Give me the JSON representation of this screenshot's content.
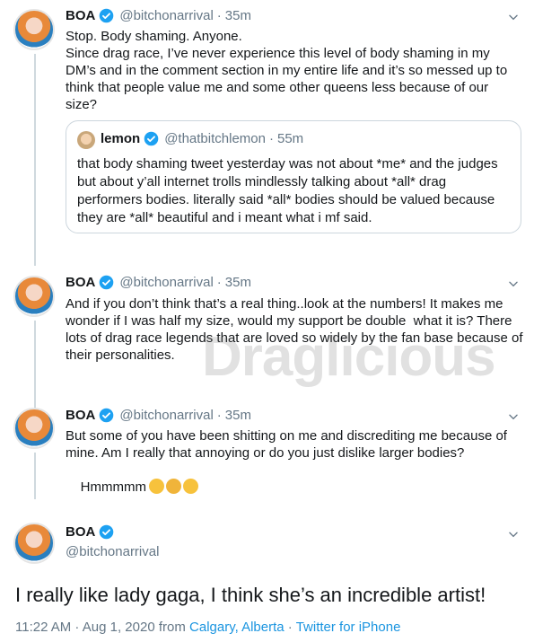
{
  "tweets": [
    {
      "name": "BOA",
      "handle": "@bitchonarrival",
      "time": "35m",
      "text": "Stop. Body shaming. Anyone.\nSince drag race, I’ve never experience this level of body shaming in my DM’s and in the comment section in my entire life and it’s so messed up to think that people value me and some other queens less because of our size?",
      "quote": {
        "name": "lemon",
        "handle": "@thatbitchlemon",
        "time": "55m",
        "text": "that body shaming tweet yesterday was not about *me* and the judges but about y’all internet trolls mindlessly talking about *all* drag performers bodies. literally said *all* bodies should be valued because they are *all* beautiful and i meant what i mf said."
      }
    },
    {
      "name": "BOA",
      "handle": "@bitchonarrival",
      "time": "35m",
      "text": "And if you don’t think that’s a real thing..look at the numbers! It makes me wonder if I was half my size, would my support be double  what it is? There lots of drag race legends that are loved so widely by the fan base because of their personalities."
    },
    {
      "name": "BOA",
      "handle": "@bitchonarrival",
      "time": "35m",
      "text": "But some of you have been shitting on me and discrediting me because of mine. Am I really that annoying or do you just dislike larger bodies?",
      "text2": "Hmmmmm"
    }
  ],
  "main": {
    "name": "BOA",
    "handle": "@bitchonarrival",
    "text": "I really like lady gaga, I think she’s an incredible artist!",
    "timestamp": "11:22 AM · Aug 1, 2020 from ",
    "location": "Calgary, Alberta",
    "separator": " · ",
    "client": "Twitter for iPhone"
  },
  "watermark": "Draglicious",
  "separator_dot": "·",
  "colors": {
    "verified": "#1da1f2",
    "link": "#1b95e0",
    "secondary": "#657786"
  }
}
